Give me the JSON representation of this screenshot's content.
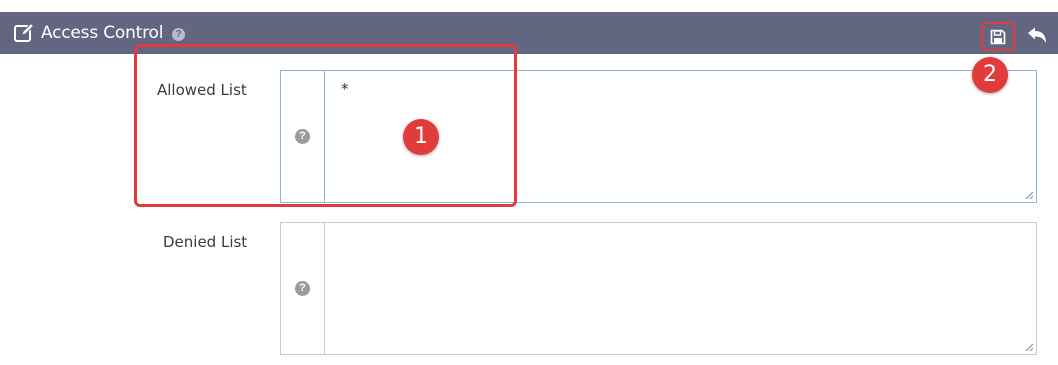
{
  "header": {
    "title": "Access Control",
    "help_glyph": "?",
    "background_color": "#626681",
    "icons": {
      "edit": "edit-icon",
      "help": "help-icon",
      "save": "save-icon",
      "back": "undo-arrow-icon"
    }
  },
  "fields": [
    {
      "label": "Allowed List",
      "value": "*",
      "help_glyph": "?",
      "help_icon": "help-icon"
    },
    {
      "label": "Denied List",
      "value": "",
      "help_glyph": "?",
      "help_icon": "help-icon"
    }
  ],
  "annotations": {
    "color": "#e23b3b",
    "badges": [
      "1",
      "2"
    ]
  }
}
